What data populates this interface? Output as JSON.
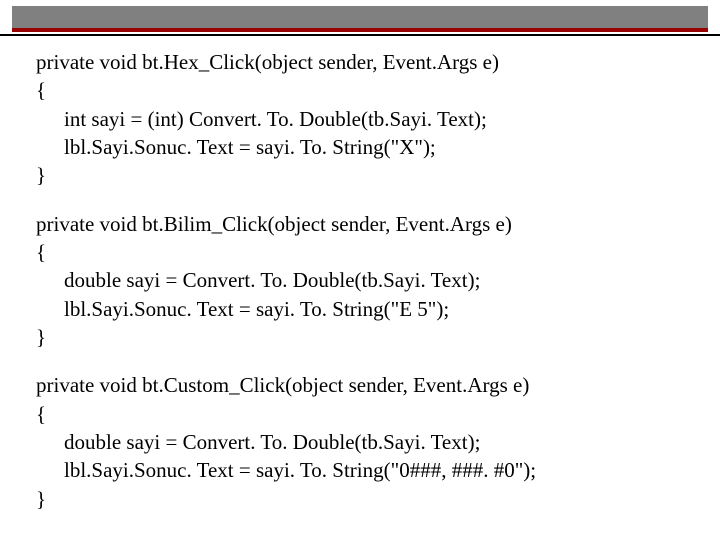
{
  "methods": [
    {
      "sig": "private void bt.Hex_Click(object sender, Event.Args e)",
      "open": "{",
      "line1": "int sayi = (int) Convert. To. Double(tb.Sayi. Text);",
      "line2": "lbl.Sayi.Sonuc. Text = sayi. To. String(\"X\");",
      "close": "}"
    },
    {
      "sig": "private void bt.Bilim_Click(object sender, Event.Args e)",
      "open": "{",
      "line1": "double sayi = Convert. To. Double(tb.Sayi. Text);",
      "line2": "lbl.Sayi.Sonuc. Text = sayi. To. String(\"E 5\");",
      "close": "}"
    },
    {
      "sig": "private void bt.Custom_Click(object sender, Event.Args e)",
      "open": "{",
      "line1": "double sayi = Convert. To. Double(tb.Sayi. Text);",
      "line2": "lbl.Sayi.Sonuc. Text = sayi. To. String(\"0###, ###. #0\");",
      "close": "}"
    }
  ]
}
